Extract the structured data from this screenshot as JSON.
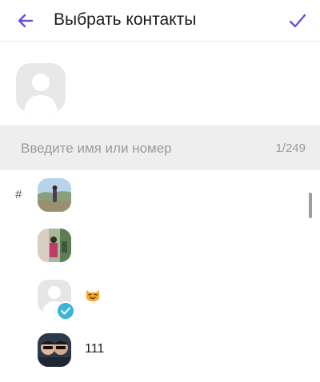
{
  "header": {
    "title": "Выбрать контакты",
    "back_icon": "arrow-left-icon",
    "confirm_icon": "checkmark-icon",
    "accent_color": "#6a4fd8"
  },
  "search": {
    "placeholder": "Введите имя или номер",
    "value": "",
    "counter": "1/249"
  },
  "contacts": {
    "section_letter": "#",
    "items": [
      {
        "name": "",
        "avatar": "photo-landscape-avatar",
        "selected": false
      },
      {
        "name": "",
        "avatar": "photo-person-avatar",
        "selected": false
      },
      {
        "name": "",
        "avatar": "default-avatar",
        "emoji": "cat-face-emoji",
        "selected": true
      },
      {
        "name": "111",
        "avatar": "photo-two-people-avatar",
        "selected": false
      }
    ]
  },
  "colors": {
    "accent": "#6a4fd8",
    "check_badge": "#3bb4d8",
    "search_bg": "#eeeeee"
  }
}
